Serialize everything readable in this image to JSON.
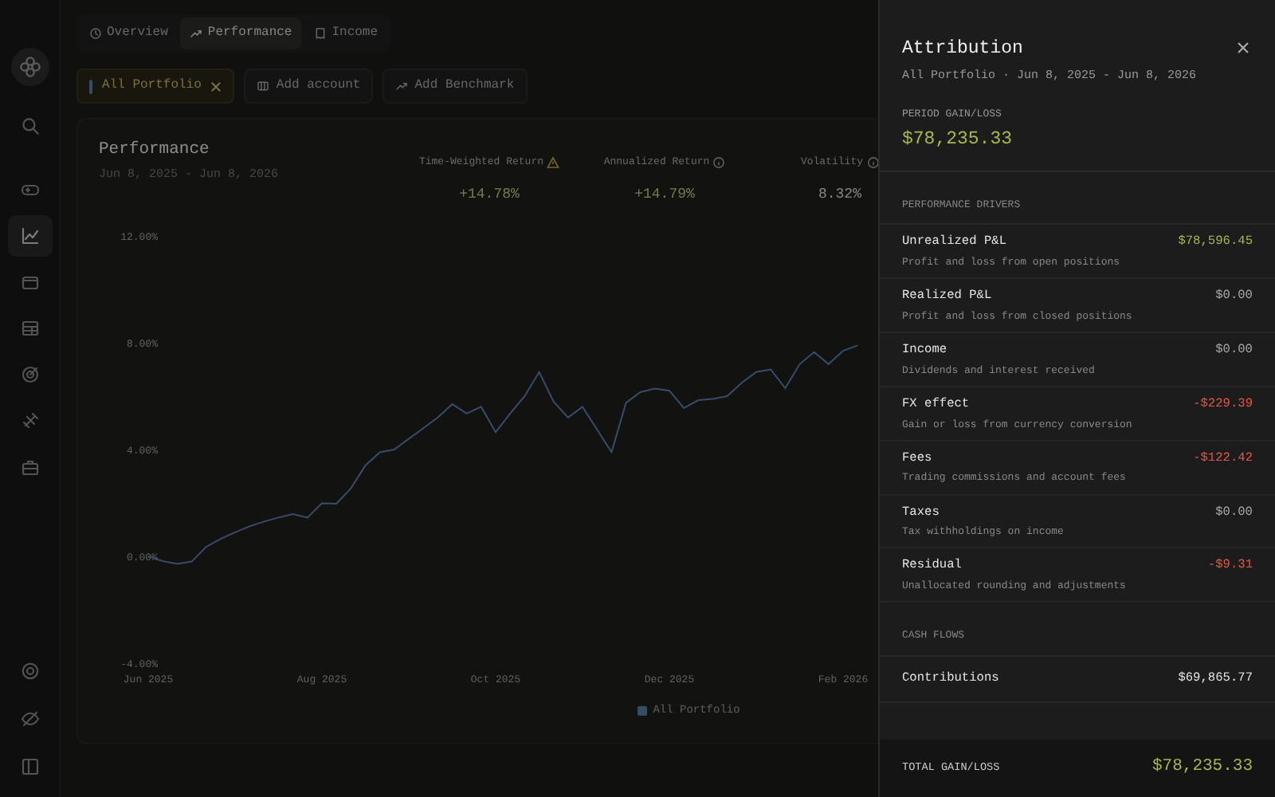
{
  "sidebar": {
    "items": [
      {
        "selected": false
      },
      {
        "selected": false
      },
      {
        "selected": true
      },
      {
        "selected": false
      },
      {
        "selected": false
      },
      {
        "selected": false
      },
      {
        "selected": false
      },
      {
        "selected": false
      }
    ],
    "bottom_items": [
      {
        "selected": false
      },
      {
        "selected": false
      },
      {
        "selected": false
      }
    ]
  },
  "tabs": [
    {
      "label": "Overview",
      "selected": false
    },
    {
      "label": "Performance",
      "selected": true
    },
    {
      "label": "Income",
      "selected": false
    }
  ],
  "portfolio_chips": [
    {
      "label": "All Portfolio",
      "selected": true
    }
  ],
  "actions": [
    {
      "label": "Add account"
    },
    {
      "label": "Add Benchmark"
    }
  ],
  "performance_card": {
    "title": "Performance",
    "subtitle": "Jun 8, 2025 - Jun 8, 2026",
    "metrics": [
      {
        "label": "Time-Weighted Return",
        "alert": true,
        "value": "+14.78%",
        "kind": "gain"
      },
      {
        "label": "Annualized Return",
        "alert": false,
        "value": "+14.79%",
        "kind": "gain"
      },
      {
        "label": "Volatility",
        "alert": false,
        "value": "8.32%",
        "kind": "plain"
      }
    ],
    "chart_data": {
      "type": "line",
      "categories": [
        "Jun 2025",
        null,
        null,
        null,
        null,
        null,
        null,
        null,
        null,
        null,
        null,
        null,
        "Aug 2025",
        null,
        null,
        null,
        null,
        null,
        null,
        null,
        null,
        null,
        null,
        null,
        "Oct 2025",
        null,
        null,
        null,
        null,
        null,
        null,
        null,
        null,
        null,
        null,
        null,
        "Dec 2025",
        null,
        null,
        null,
        null,
        null,
        null,
        null,
        null,
        null,
        null,
        null,
        "Feb 2026",
        null
      ],
      "yticks": [
        {
          "value": 12,
          "label": "12.00%"
        },
        {
          "value": 8,
          "label": "8.00%"
        },
        {
          "value": 4,
          "label": "4.00%"
        },
        {
          "value": 0,
          "label": "0.00%"
        },
        {
          "value": -4,
          "label": "-4.00%"
        }
      ],
      "ylim": [
        -4,
        12
      ],
      "series": [
        {
          "name": "All Portfolio",
          "color": "#5b7fb0",
          "values": [
            0,
            -0.18,
            -0.28,
            -0.2,
            0.35,
            0.65,
            0.9,
            1.12,
            1.3,
            1.45,
            1.58,
            1.45,
            1.98,
            1.97,
            2.55,
            3.4,
            3.9,
            4.0,
            4.4,
            4.8,
            5.2,
            5.7,
            5.35,
            5.6,
            4.65,
            5.35,
            6.0,
            6.9,
            5.8,
            5.2,
            5.6,
            4.75,
            3.9,
            5.75,
            6.15,
            6.28,
            6.2,
            5.55,
            5.85,
            5.9,
            6.0,
            6.5,
            6.9,
            7.0,
            6.3,
            7.2,
            7.65,
            7.2,
            7.7,
            7.9
          ]
        }
      ]
    }
  },
  "drawer": {
    "title": "Attribution",
    "subtitle": "All Portfolio · Jun 8, 2025 - Jun 8, 2026",
    "period_label": "PERIOD GAIN/LOSS",
    "period_value": "$78,235.33",
    "sections": [
      {
        "heading": "PERFORMANCE DRIVERS",
        "items": [
          {
            "name": "Unrealized P&L",
            "description": "Profit and loss from open positions",
            "value": "$78,596.45",
            "kind": "gain"
          },
          {
            "name": "Realized P&L",
            "description": "Profit and loss from closed positions",
            "value": "$0.00",
            "kind": "zero"
          },
          {
            "name": "Income",
            "description": "Dividends and interest received",
            "value": "$0.00",
            "kind": "zero"
          },
          {
            "name": "FX effect",
            "description": "Gain or loss from currency conversion",
            "value": "-$229.39",
            "kind": "loss"
          },
          {
            "name": "Fees",
            "description": "Trading commissions and account fees",
            "value": "-$122.42",
            "kind": "loss"
          },
          {
            "name": "Taxes",
            "description": "Tax withholdings on income",
            "value": "$0.00",
            "kind": "zero"
          },
          {
            "name": "Residual",
            "description": "Unallocated rounding and adjustments",
            "value": "-$9.31",
            "kind": "loss"
          }
        ]
      },
      {
        "heading": "CASH FLOWS",
        "items": [
          {
            "name": "Contributions",
            "value": "$69,865.77",
            "kind": "plain"
          }
        ]
      }
    ],
    "total": {
      "label": "TOTAL GAIN/LOSS",
      "value": "$78,235.33"
    }
  }
}
